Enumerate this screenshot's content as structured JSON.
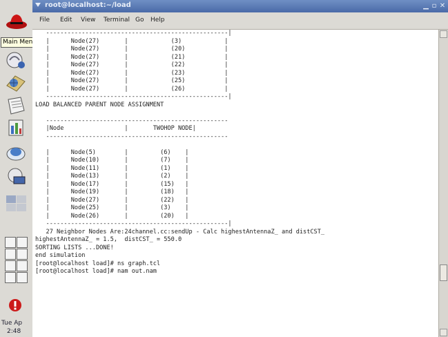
{
  "window": {
    "title": "root@localhost:~/load",
    "menu": [
      "File",
      "Edit",
      "View",
      "Terminal",
      "Go",
      "Help"
    ],
    "menu_mnemonics": [
      "F",
      "E",
      "V",
      "T",
      "G",
      "H"
    ]
  },
  "panel": {
    "main_menu_tooltip": "Main Menu",
    "clock_line1": "Tue Ap",
    "clock_line2": "2:48"
  },
  "terminal": {
    "lines": [
      "   ---------------------------------------------------|",
      "   |      Node(27)       |            (3)            |",
      "   |      Node(27)       |            (20)           |",
      "   |      Node(27)       |            (21)           |",
      "   |      Node(27)       |            (22)           |",
      "   |      Node(27)       |            (23)           |",
      "   |      Node(27)       |            (25)           |",
      "   |      Node(27)       |            (26)           |",
      "   ---------------------------------------------------|",
      "LOAD BALANCED PARENT NODE ASSIGNMENT",
      "",
      "   ---------------------------------------------------",
      "   |Node                 |       TWOHOP NODE|",
      "   ---------------------------------------------------",
      "",
      "   |      Node(5)        |         (6)    |",
      "   |      Node(10)       |         (7)    |",
      "   |      Node(11)       |         (1)    |",
      "   |      Node(13)       |         (2)    |",
      "   |      Node(17)       |         (15)   |",
      "   |      Node(19)       |         (18)   |",
      "   |      Node(27)       |         (22)   |",
      "   |      Node(25)       |         (3)    |",
      "   |      Node(26)       |         (20)   |",
      "   ---------------------------------------------------|",
      "   27 Neighbor Nodes Are:24channel.cc:sendUp - Calc highestAntennaZ_ and distCST_",
      "highestAntennaZ_ = 1.5,  distCST_ = 550.0",
      "SORTING LISTS ...DONE!",
      "end simulation",
      "[root@localhost load]# ns graph.tcl",
      "[root@localhost load]# nam out.nam"
    ]
  },
  "icons": {
    "launcher": [
      "redhat-icon",
      "mail-icon",
      "network-icon",
      "writer-icon",
      "calc-icon",
      "impress-icon",
      "print-icon",
      "workspace-icon"
    ]
  },
  "colors": {
    "titlebar": "#4a6aa8",
    "panel": "#dcdad5",
    "terminal_bg": "#ffffff",
    "terminal_fg": "#222222"
  }
}
